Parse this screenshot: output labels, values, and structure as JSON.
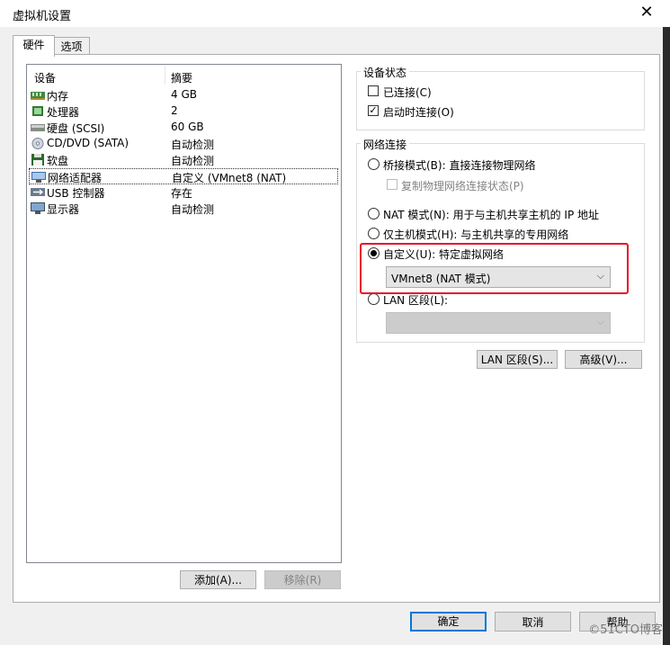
{
  "window": {
    "title": "虚拟机设置"
  },
  "tabs": [
    {
      "label": "硬件"
    },
    {
      "label": "选项"
    }
  ],
  "device_list": {
    "headers": {
      "device": "设备",
      "summary": "摘要"
    },
    "rows": [
      {
        "name": "内存",
        "summary": "4 GB",
        "icon": "memory-icon"
      },
      {
        "name": "处理器",
        "summary": "2",
        "icon": "processor-icon"
      },
      {
        "name": "硬盘 (SCSI)",
        "summary": "60 GB",
        "icon": "hard-disk-icon"
      },
      {
        "name": "CD/DVD (SATA)",
        "summary": "自动检测",
        "icon": "cd-dvd-icon"
      },
      {
        "name": "软盘",
        "summary": "自动检测",
        "icon": "floppy-icon"
      },
      {
        "name": "网络适配器",
        "summary": "自定义 (VMnet8 (NAT)",
        "icon": "network-adapter-icon"
      },
      {
        "name": "USB 控制器",
        "summary": "存在",
        "icon": "usb-icon"
      },
      {
        "name": "显示器",
        "summary": "自动检测",
        "icon": "display-icon"
      }
    ]
  },
  "left_buttons": {
    "add": "添加(A)...",
    "remove": "移除(R)"
  },
  "device_status": {
    "title": "设备状态",
    "connected": {
      "label": "已连接(C)",
      "checked": false
    },
    "connect_at_power_on": {
      "label": "启动时连接(O)",
      "checked": true
    }
  },
  "network": {
    "title": "网络连接",
    "bridged": {
      "label": "桥接模式(B): 直接连接物理网络",
      "selected": false
    },
    "replicate": {
      "label": "复制物理网络连接状态(P)",
      "checked": false,
      "disabled": true
    },
    "nat": {
      "label": "NAT 模式(N): 用于与主机共享主机的 IP 地址",
      "selected": false
    },
    "host_only": {
      "label": "仅主机模式(H): 与主机共享的专用网络",
      "selected": false
    },
    "custom": {
      "label": "自定义(U): 特定虚拟网络",
      "selected": true
    },
    "custom_select_value": "VMnet8 (NAT 模式)",
    "lan_segment": {
      "label": "LAN 区段(L):",
      "selected": false
    },
    "lan_select_value": ""
  },
  "right_buttons": {
    "lan_segments": "LAN 区段(S)...",
    "advanced": "高级(V)..."
  },
  "footer": {
    "ok": "确定",
    "cancel": "取消",
    "help": "帮助"
  },
  "watermark": "©51CTO博客",
  "colors": {
    "highlight_box": "#e81123",
    "default_button_border": "#0078d7"
  }
}
